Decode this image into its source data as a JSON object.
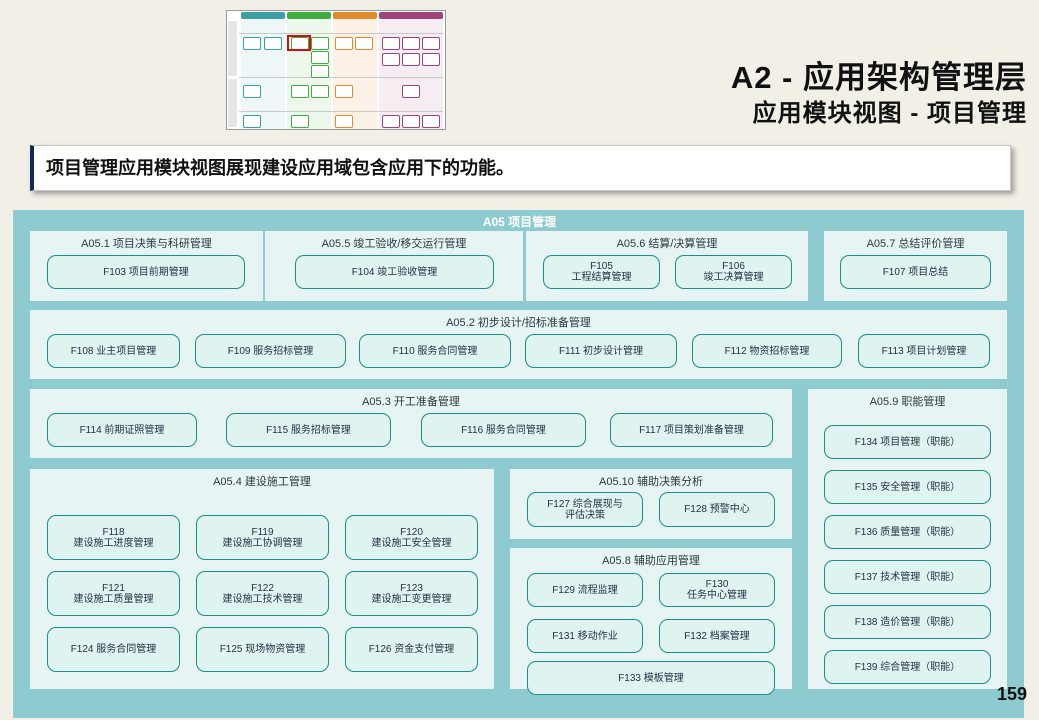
{
  "header": {
    "title": "A2 - 应用架构管理层",
    "subtitle": "应用模块视图 -  项目管理"
  },
  "description": "项目管理应用模块视图展现建设应用域包含应用下的功能。",
  "page_number": "159",
  "diagram": {
    "title": "A05 项目管理",
    "groups": {
      "g1": {
        "title": "A05.1 项目决策与科研管理",
        "modules": [
          "F103 项目前期管理"
        ]
      },
      "g5": {
        "title": "A05.5 竣工验收/移交运行管理",
        "modules": [
          "F104 竣工验收管理"
        ]
      },
      "g6": {
        "title": "A05.6 结算/决算管理",
        "modules": [
          "F105\n工程结算管理",
          "F106\n竣工决算管理"
        ]
      },
      "g7": {
        "title": "A05.7 总结评价管理",
        "modules": [
          "F107 项目总结"
        ]
      },
      "g2": {
        "title": "A05.2 初步设计/招标准备管理",
        "modules": [
          "F108 业主项目管理",
          "F109 服务招标管理",
          "F110 服务合同管理",
          "F111 初步设计管理",
          "F112 物资招标管理",
          "F113 项目计划管理"
        ]
      },
      "g3": {
        "title": "A05.3 开工准备管理",
        "modules": [
          "F114 前期证照管理",
          "F115 服务招标管理",
          "F116 服务合同管理",
          "F117 项目策划准备管理"
        ]
      },
      "g9": {
        "title": "A05.9 职能管理",
        "modules": [
          "F134 项目管理（职能）",
          "F135 安全管理（职能）",
          "F136 质量管理（职能）",
          "F137 技术管理（职能）",
          "F138 造价管理（职能）",
          "F139 综合管理（职能）"
        ]
      },
      "g4": {
        "title": "A05.4 建设施工管理",
        "modules": [
          "F118\n建设施工进度管理",
          "F119\n建设施工协调管理",
          "F120\n建设施工安全管理",
          "F121\n建设施工质量管理",
          "F122\n建设施工技术管理",
          "F123\n建设施工变更管理",
          "F124 服务合同管理",
          "F125 现场物资管理",
          "F126 资金支付管理"
        ]
      },
      "g10": {
        "title": "A05.10 辅助决策分析",
        "modules": [
          "F127 综合展现与\n评估决策",
          "F128 预警中心"
        ]
      },
      "g8": {
        "title": "A05.8 辅助应用管理",
        "modules": [
          "F129 流程监理",
          "F130\n任务中心管理",
          "F131 移动作业",
          "F132 档案管理",
          "F133 模板管理"
        ]
      }
    }
  },
  "colors": {
    "background": "#f1efe6",
    "outer": "#8ecbd1",
    "group": "#e6f4f3",
    "module_fill": "#dff3f0",
    "module_border": "#1b8e8a",
    "accent_bar": "#0f2c57",
    "highlight": "#d01010"
  }
}
